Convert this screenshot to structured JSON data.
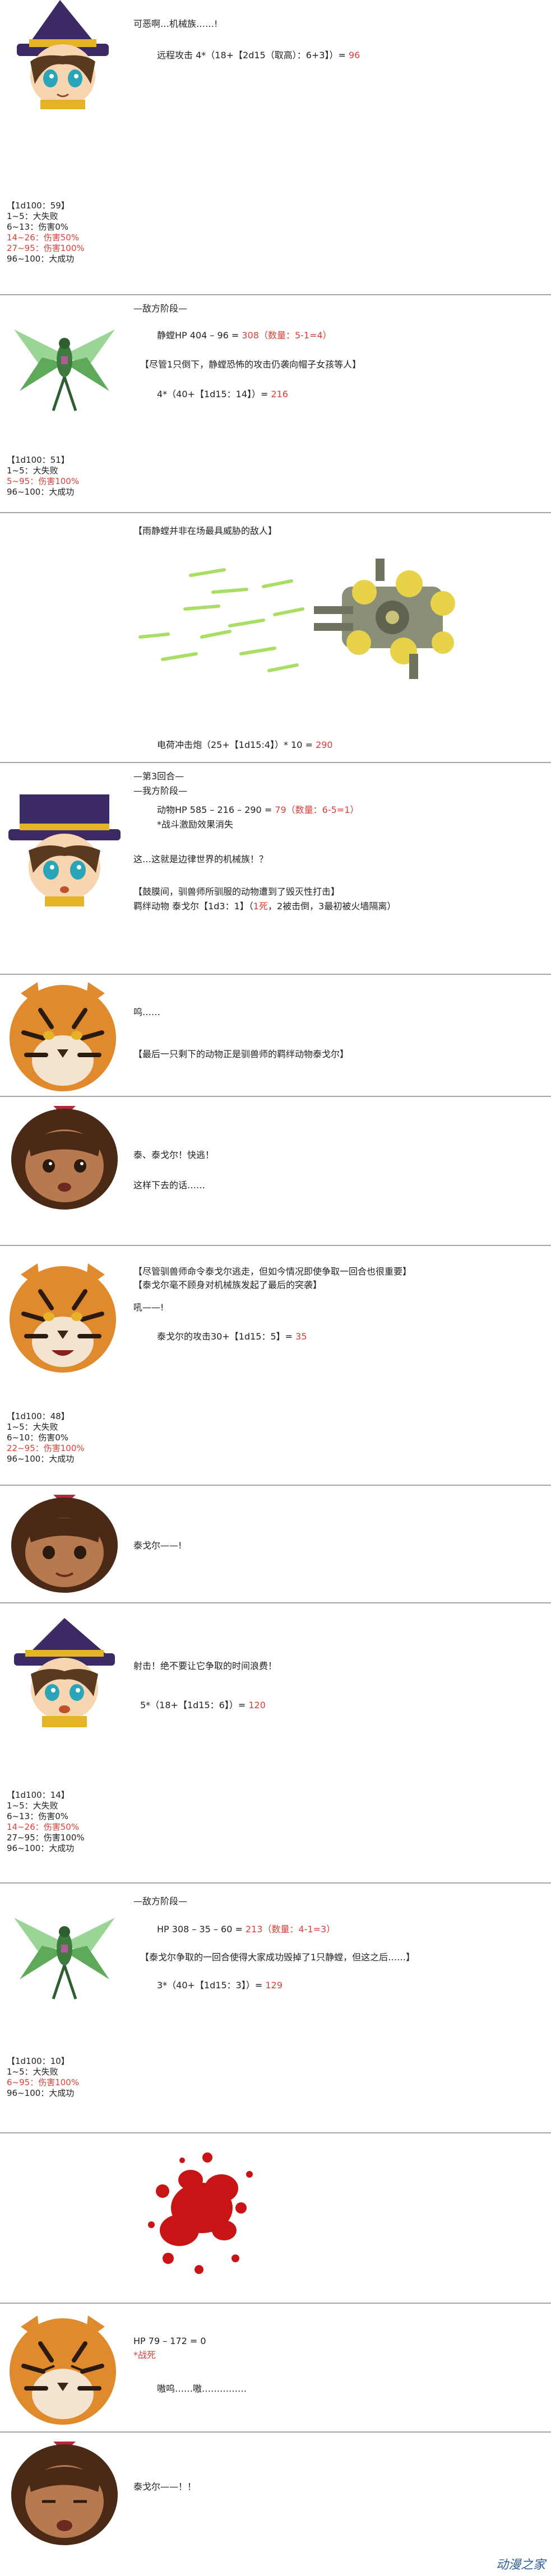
{
  "panels": {
    "p1": {
      "line1": "可恶啊…机械族……!",
      "calc_prefix": "远程攻击 4*（18+【2d15（取高）：6+3】）= ",
      "calc_result": "96",
      "roll_title": "【1d100：59】",
      "roll_rows": [
        "1~5：大失败",
        "6~13：伤害0%",
        "14~26：伤害50%",
        "27~95：伤害100%",
        "96~100：大成功"
      ]
    },
    "p2": {
      "phase": "—敌方阶段—",
      "hp_prefix": "静螳HP 404 – 96 = ",
      "hp_result": "308（数量：5-1=4）",
      "note": "【尽管1只倒下，静螳恐怖的攻击仍袭向帽子女孩等人】",
      "calc": "4*（40+【1d15：14】）= ",
      "calc_result": "216",
      "roll_title": "【1d100：51】",
      "roll_rows": [
        "1~5：大失败",
        "5~95：伤害100%",
        "96~100：大成功"
      ]
    },
    "p3": {
      "title": "【雨静螳并非在场最具威胁的敌人】",
      "calc": "电荷冲击炮（25+【1d15:4】）* 10 = ",
      "calc_result": "290"
    },
    "p4": {
      "round": "—第3回合—",
      "phase": "—我方阶段—",
      "hp_prefix": "动物HP 585 – 216 – 290 = ",
      "hp_result": "79（数量：6-5=1）",
      "note": "*战斗激励效果消失",
      "line": "这…这就是边律世界的机械族！？",
      "event1": "【鼓膜间，驯兽师所驯服的动物遭到了毁灭性打击】",
      "event2_prefix": "羁绊动物 泰戈尔【1d3：1】（",
      "event2_red": "1死",
      "event2_suffix": "，2被击倒，3最初被火墙隔离）"
    },
    "p5": {
      "line1": "呜……",
      "line2": "【最后一只剩下的动物正是驯兽师的羁绊动物泰戈尔】"
    },
    "p6": {
      "line1": "泰、泰戈尔！快逃！",
      "line2": "这样下去的话……"
    },
    "p7": {
      "note1": "【尽管驯兽师命令泰戈尔逃走，但如今情况即使争取一回合也很重要】",
      "note2": "【泰戈尔毫不顾身对机械族发起了最后的突袭】",
      "roar": "吼——!",
      "calc": "泰戈尔的攻击30+【1d15：5】= ",
      "calc_result": "35",
      "roll_title": "【1d100：48】",
      "roll_rows": [
        "1~5：大失败",
        "6~10：伤害0%",
        "22~95：伤害100%",
        "96~100：大成功"
      ]
    },
    "p8": {
      "line1": "泰戈尔——!"
    },
    "p9": {
      "line1": "射击！绝不要让它争取的时间浪费！",
      "calc": "5*（18+【1d15：6】）= ",
      "calc_result": "120",
      "roll_title": "【1d100：14】",
      "roll_rows": [
        "1~5：大失败",
        "6~13：伤害0%",
        "14~26：伤害50%",
        "27~95：伤害100%",
        "96~100：大成功"
      ]
    },
    "p10": {
      "phase": "—敌方阶段—",
      "hp_prefix": "HP 308 – 35 – 60 = ",
      "hp_result": "213（数量：4-1=3）",
      "note": "【泰戈尔争取的一回合使得大家成功毁掉了1只静螳，但这之后……】",
      "calc": "3*（40+【1d15：3】）= ",
      "calc_result": "129",
      "roll_title": "【1d100：10】",
      "roll_rows": [
        "1~5：大失败",
        "6~95：伤害100%",
        "96~100：大成功"
      ]
    },
    "p12": {
      "hp": "HP 79 – 172 = 0",
      "dead": "*战死",
      "line": "嗷呜……嗷……………"
    },
    "p13": {
      "line1": "泰戈尔——！！"
    }
  },
  "watermark": "动漫之家",
  "colors": {
    "accent_red": "#d9403a",
    "divider": "#a6a6a6"
  },
  "icons": [
    "hat-kid-avatar",
    "mantis-robot-icon",
    "war-machine-icon",
    "tiger-avatar",
    "tamer-girl-avatar",
    "blood-splatter-icon"
  ]
}
